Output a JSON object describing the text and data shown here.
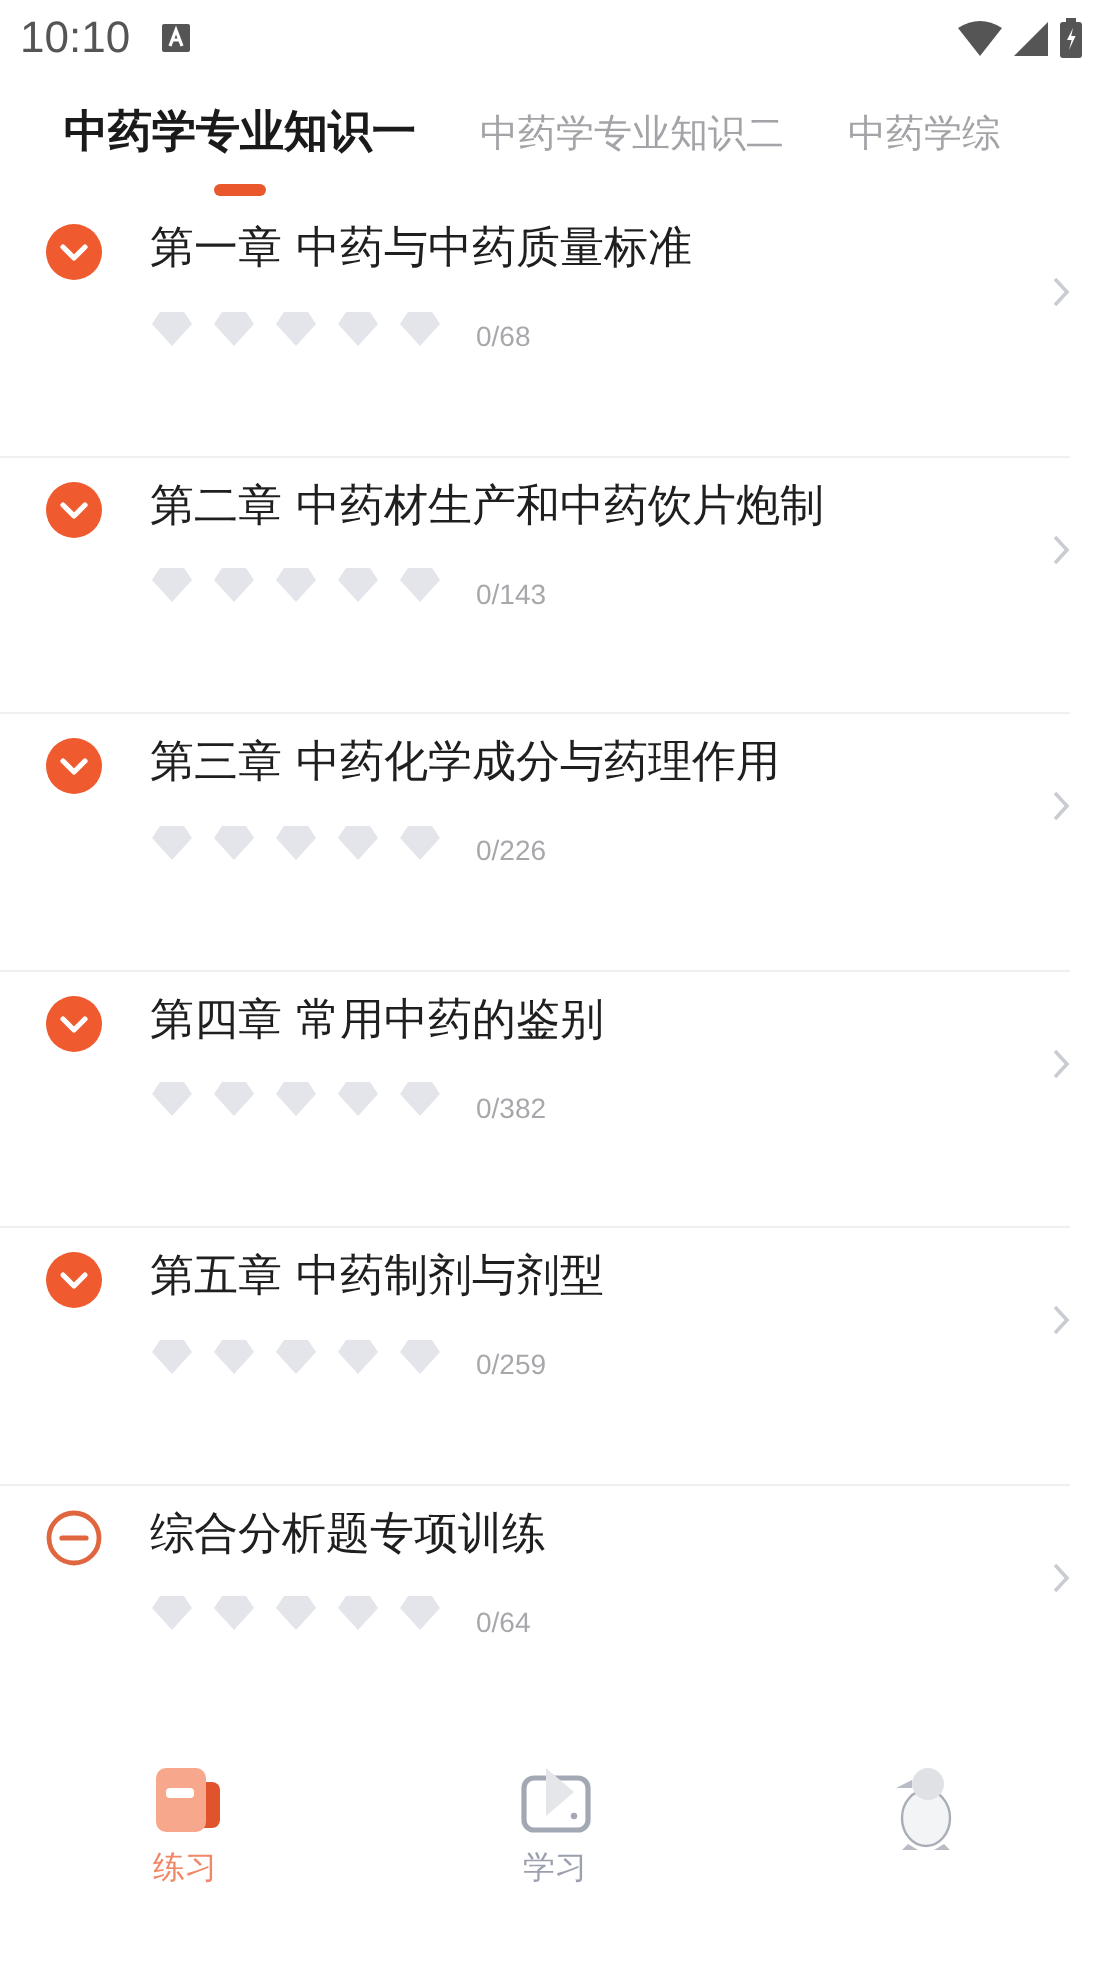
{
  "status_bar": {
    "time": "10:10"
  },
  "tabs": [
    {
      "label": "中药学专业知识一",
      "selected": true
    },
    {
      "label": "中药学专业知识二",
      "selected": false
    },
    {
      "label": "中药学综",
      "selected": false
    }
  ],
  "chapters": [
    {
      "kind": "chapter",
      "title": "第一章 中药与中药质量标准",
      "stars": 0,
      "count": "0/68"
    },
    {
      "kind": "chapter",
      "title": "第二章 中药材生产和中药饮片炮制",
      "stars": 0,
      "count": "0/143"
    },
    {
      "kind": "chapter",
      "title": "第三章 中药化学成分与药理作用",
      "stars": 0,
      "count": "0/226"
    },
    {
      "kind": "chapter",
      "title": "第四章 常用中药的鉴别",
      "stars": 0,
      "count": "0/382"
    },
    {
      "kind": "chapter",
      "title": "第五章 中药制剂与剂型",
      "stars": 0,
      "count": "0/259"
    },
    {
      "kind": "special",
      "title": "综合分析题专项训练",
      "stars": 0,
      "count": "0/64"
    }
  ],
  "bottom_nav": [
    {
      "kind": "practice",
      "label": "练习",
      "selected": true
    },
    {
      "kind": "study",
      "label": "学习",
      "selected": false
    },
    {
      "kind": "profile",
      "selected": false
    }
  ]
}
